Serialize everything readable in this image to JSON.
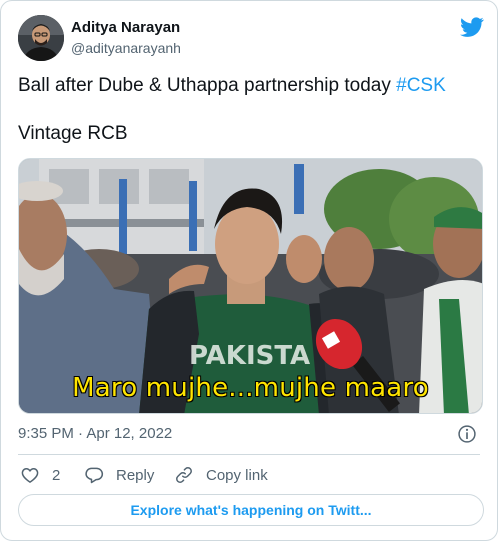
{
  "author": {
    "name": "Aditya Narayan",
    "handle": "@adityanarayanh"
  },
  "tweet": {
    "text_plain": "Ball after Dube & Uthappa partnership today ",
    "hashtag": "#CSK",
    "line2": "Vintage RCB"
  },
  "media": {
    "caption": "Maro mujhe...mujhe maaro",
    "jersey_text": "PAKISTA"
  },
  "meta": {
    "timestamp": "9:35 PM · Apr 12, 2022"
  },
  "actions": {
    "like_count": "2",
    "reply_label": "Reply",
    "copy_label": "Copy link"
  },
  "explore": {
    "label": "Explore what's happening on Twitt..."
  },
  "colors": {
    "accent": "#1d9bf0",
    "text": "#0f1419",
    "muted": "#536471",
    "border": "#cfd9de",
    "caption": "#ffe500"
  },
  "icons": {
    "brand": "twitter-bird-icon",
    "info": "info-icon",
    "like": "heart-icon",
    "reply": "reply-bubble-icon",
    "copy": "link-icon"
  }
}
